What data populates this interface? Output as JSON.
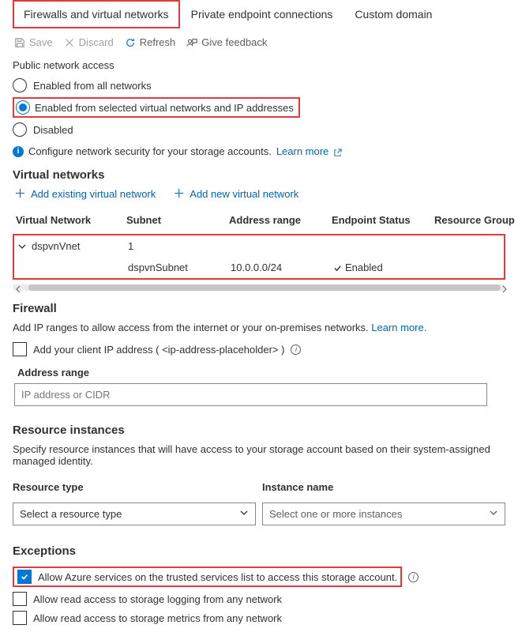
{
  "tabs": {
    "t1": "Firewalls and virtual networks",
    "t2": "Private endpoint connections",
    "t3": "Custom domain"
  },
  "toolbar": {
    "save": "Save",
    "discard": "Discard",
    "refresh": "Refresh",
    "feedback": "Give feedback"
  },
  "pna": {
    "heading": "Public network access",
    "opt1": "Enabled from all networks",
    "opt2": "Enabled from selected virtual networks and IP addresses",
    "opt3": "Disabled",
    "info": "Configure network security for your storage accounts.",
    "learn": "Learn more"
  },
  "vnets": {
    "title": "Virtual networks",
    "add_existing": "Add existing virtual network",
    "add_new": "Add new virtual network",
    "cols": {
      "c1": "Virtual Network",
      "c2": "Subnet",
      "c3": "Address range",
      "c4": "Endpoint Status",
      "c5": "Resource Group"
    },
    "row1": {
      "name": "dspvnVnet",
      "subnet_count": "1"
    },
    "row2": {
      "subnet": "dspvnSubnet",
      "range": "10.0.0.0/24",
      "status": "Enabled"
    }
  },
  "firewall": {
    "title": "Firewall",
    "desc": "Add IP ranges to allow access from the internet or your on-premises networks.",
    "learn": "Learn more.",
    "add_client": "Add your client IP address ( <ip-address-placeholder> )",
    "range_label": "Address range",
    "placeholder": "IP address or CIDR"
  },
  "resinst": {
    "title": "Resource instances",
    "desc": "Specify resource instances that will have access to your storage account based on their system-assigned managed identity.",
    "col_type": "Resource type",
    "col_name": "Instance name",
    "type_ph": "Select a resource type",
    "name_ph": "Select one or more instances"
  },
  "exceptions": {
    "title": "Exceptions",
    "e1": "Allow Azure services on the trusted services list to access this storage account.",
    "e2": "Allow read access to storage logging from any network",
    "e3": "Allow read access to storage metrics from any network"
  }
}
